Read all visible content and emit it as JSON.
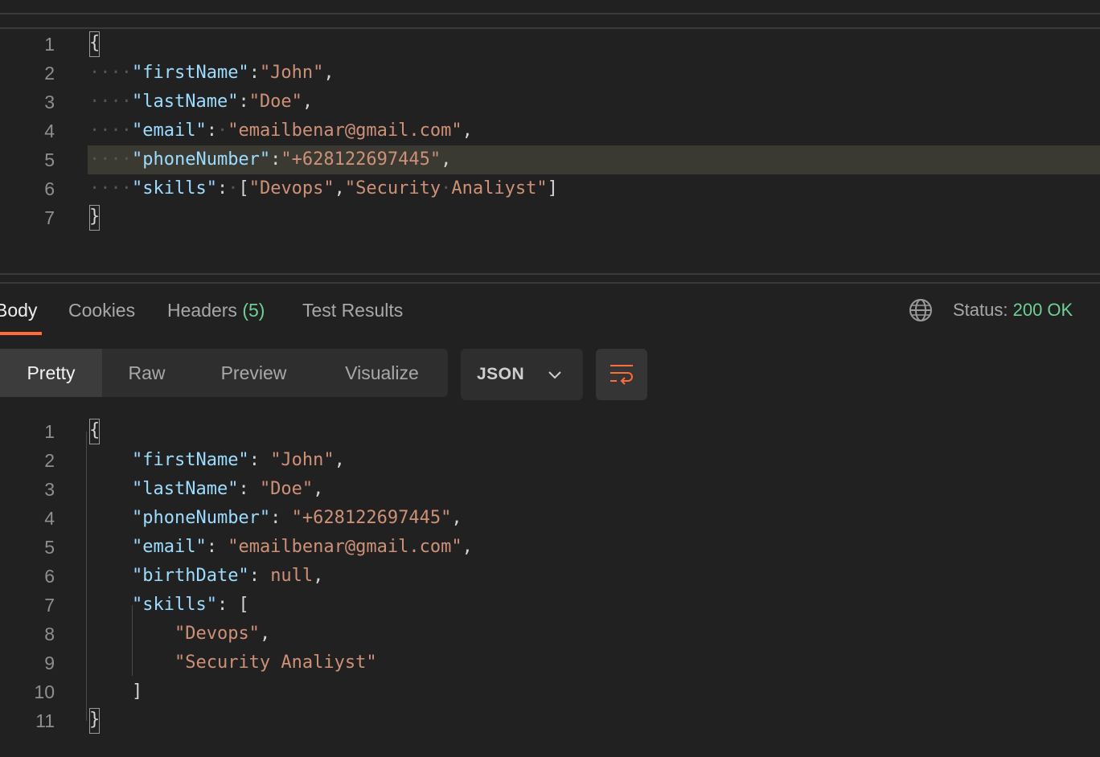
{
  "request_editor": {
    "line_numbers": [
      "1",
      "2",
      "3",
      "4",
      "5",
      "6",
      "7"
    ],
    "lines": [
      [
        {
          "t": "{",
          "c": "brace"
        }
      ],
      [
        {
          "t": "····",
          "c": "ws"
        },
        {
          "t": "\"firstName\"",
          "c": "k"
        },
        {
          "t": ":",
          "c": "p"
        },
        {
          "t": "\"John\"",
          "c": "s"
        },
        {
          "t": ",",
          "c": "p"
        }
      ],
      [
        {
          "t": "····",
          "c": "ws"
        },
        {
          "t": "\"lastName\"",
          "c": "k"
        },
        {
          "t": ":",
          "c": "p"
        },
        {
          "t": "\"Doe\"",
          "c": "s"
        },
        {
          "t": ",",
          "c": "p"
        }
      ],
      [
        {
          "t": "····",
          "c": "ws"
        },
        {
          "t": "\"email\"",
          "c": "k"
        },
        {
          "t": ":",
          "c": "p"
        },
        {
          "t": "·",
          "c": "ws"
        },
        {
          "t": "\"emailbenar@gmail.com\"",
          "c": "s"
        },
        {
          "t": ",",
          "c": "p"
        }
      ],
      [
        {
          "t": "····",
          "c": "ws"
        },
        {
          "t": "\"phoneNumber\"",
          "c": "k"
        },
        {
          "t": ":",
          "c": "p"
        },
        {
          "t": "\"+628122697445\"",
          "c": "s"
        },
        {
          "t": ",",
          "c": "p"
        }
      ],
      [
        {
          "t": "····",
          "c": "ws"
        },
        {
          "t": "\"skills\"",
          "c": "k"
        },
        {
          "t": ":",
          "c": "p"
        },
        {
          "t": "·",
          "c": "ws"
        },
        {
          "t": "[",
          "c": "p"
        },
        {
          "t": "\"Devops\"",
          "c": "s"
        },
        {
          "t": ",",
          "c": "p"
        },
        {
          "t": "\"Security",
          "c": "s"
        },
        {
          "t": "·",
          "c": "ws"
        },
        {
          "t": "Analiyst\"",
          "c": "s"
        },
        {
          "t": "]",
          "c": "p"
        }
      ],
      [
        {
          "t": "}",
          "c": "brace"
        }
      ]
    ]
  },
  "response_tabs": {
    "body": "Body",
    "cookies": "Cookies",
    "headers": "Headers",
    "headers_count": "(5)",
    "test_results": "Test Results"
  },
  "status": {
    "label": "Status:",
    "value": "200 OK"
  },
  "view_modes": {
    "pretty": "Pretty",
    "raw": "Raw",
    "preview": "Preview",
    "visualize": "Visualize"
  },
  "format": {
    "selected": "JSON"
  },
  "response_body": {
    "line_numbers": [
      "1",
      "2",
      "3",
      "4",
      "5",
      "6",
      "7",
      "8",
      "9",
      "10",
      "11"
    ],
    "lines": [
      [
        {
          "t": "{",
          "c": "brace"
        }
      ],
      [
        {
          "t": "    ",
          "c": "p"
        },
        {
          "t": "\"firstName\"",
          "c": "k"
        },
        {
          "t": ": ",
          "c": "p"
        },
        {
          "t": "\"John\"",
          "c": "s"
        },
        {
          "t": ",",
          "c": "p"
        }
      ],
      [
        {
          "t": "    ",
          "c": "p"
        },
        {
          "t": "\"lastName\"",
          "c": "k"
        },
        {
          "t": ": ",
          "c": "p"
        },
        {
          "t": "\"Doe\"",
          "c": "s"
        },
        {
          "t": ",",
          "c": "p"
        }
      ],
      [
        {
          "t": "    ",
          "c": "p"
        },
        {
          "t": "\"phoneNumber\"",
          "c": "k"
        },
        {
          "t": ": ",
          "c": "p"
        },
        {
          "t": "\"+628122697445\"",
          "c": "s"
        },
        {
          "t": ",",
          "c": "p"
        }
      ],
      [
        {
          "t": "    ",
          "c": "p"
        },
        {
          "t": "\"email\"",
          "c": "k"
        },
        {
          "t": ": ",
          "c": "p"
        },
        {
          "t": "\"emailbenar@gmail.com\"",
          "c": "s"
        },
        {
          "t": ",",
          "c": "p"
        }
      ],
      [
        {
          "t": "    ",
          "c": "p"
        },
        {
          "t": "\"birthDate\"",
          "c": "k"
        },
        {
          "t": ": ",
          "c": "p"
        },
        {
          "t": "null",
          "c": "n"
        },
        {
          "t": ",",
          "c": "p"
        }
      ],
      [
        {
          "t": "    ",
          "c": "p"
        },
        {
          "t": "\"skills\"",
          "c": "k"
        },
        {
          "t": ": [",
          "c": "p"
        }
      ],
      [
        {
          "t": "        ",
          "c": "p"
        },
        {
          "t": "\"Devops\"",
          "c": "s"
        },
        {
          "t": ",",
          "c": "p"
        }
      ],
      [
        {
          "t": "        ",
          "c": "p"
        },
        {
          "t": "\"Security Analiyst\"",
          "c": "s"
        }
      ],
      [
        {
          "t": "    ]",
          "c": "p"
        }
      ],
      [
        {
          "t": "}",
          "c": "brace"
        }
      ]
    ]
  },
  "colors": {
    "accent": "#ff6c37",
    "status_ok": "#6fcf97",
    "json_key": "#9cdcfe",
    "json_string": "#ce9178"
  },
  "icons": [
    "globe-icon",
    "chevron-down-icon",
    "word-wrap-icon"
  ]
}
